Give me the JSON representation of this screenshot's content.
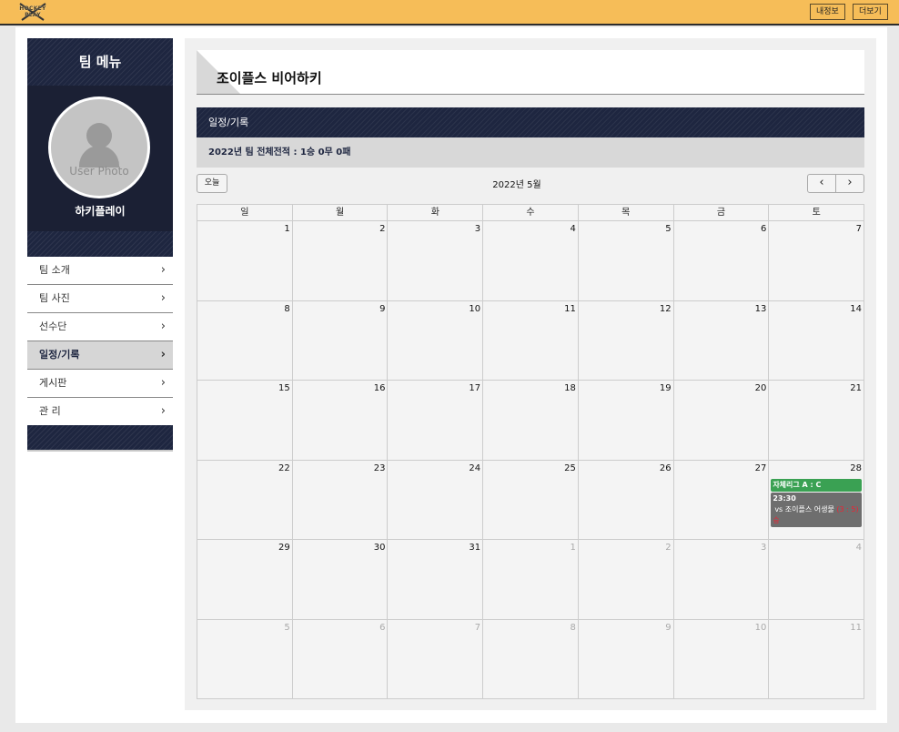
{
  "header": {
    "logo_line1": "HOCKEY",
    "logo_line2": "PLAY",
    "my_info_label": "내정보",
    "more_label": "더보기"
  },
  "sidebar": {
    "title": "팀 메뉴",
    "avatar_placeholder": "User Photo",
    "profile_name": "하키플레이",
    "items": [
      {
        "label": "팀 소개"
      },
      {
        "label": "팀 사진"
      },
      {
        "label": "선수단"
      },
      {
        "label": "일정/기록",
        "active": true
      },
      {
        "label": "게시판"
      },
      {
        "label": "관 리"
      }
    ]
  },
  "main": {
    "team_name": "조이플스 비어하키",
    "section_title": "일정/기록",
    "record_summary": "2022년 팀 전체전적 : 1승 0무 0패"
  },
  "calendar": {
    "today_label": "오늘",
    "title": "2022년 5월",
    "prev_icon": "‹",
    "next_icon": "›",
    "weekdays": [
      "일",
      "월",
      "화",
      "수",
      "목",
      "금",
      "토"
    ],
    "weeks": [
      [
        "1",
        "2",
        "3",
        "4",
        "5",
        "6",
        "7"
      ],
      [
        "8",
        "9",
        "10",
        "11",
        "12",
        "13",
        "14"
      ],
      [
        "15",
        "16",
        "17",
        "18",
        "19",
        "20",
        "21"
      ],
      [
        "22",
        "23",
        "24",
        "25",
        "26",
        "27",
        "28"
      ],
      [
        "29",
        "30",
        "31",
        "1",
        "2",
        "3",
        "4"
      ],
      [
        "5",
        "6",
        "7",
        "8",
        "9",
        "10",
        "11"
      ]
    ],
    "events": {
      "league_label": "자체리그 A : C",
      "game_time": "23:30",
      "game_opponent": "vs 조이플스 어생물",
      "game_result": "(3 : 5) 승"
    }
  }
}
